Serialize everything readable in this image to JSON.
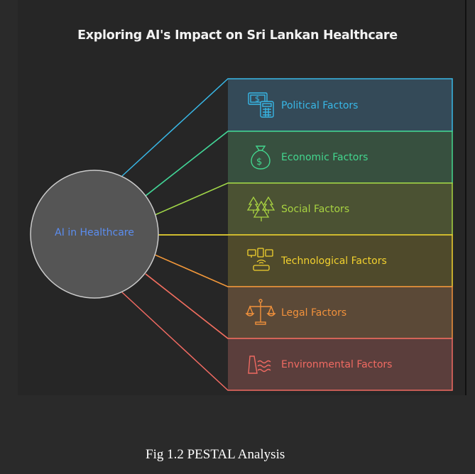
{
  "title": "Exploring AI's Impact on Sri Lankan Healthcare",
  "center": {
    "label": "AI in Healthcare",
    "color": "#5b8def"
  },
  "factors": [
    {
      "label": "Political Factors",
      "color": "#38b7e6",
      "fill": "#344a58",
      "icon": "money-calculator-icon"
    },
    {
      "label": "Economic Factors",
      "color": "#43d68e",
      "fill": "#37503f",
      "icon": "money-bag-icon"
    },
    {
      "label": "Social Factors",
      "color": "#a8d341",
      "fill": "#4b5233",
      "icon": "trees-icon"
    },
    {
      "label": "Technological Factors",
      "color": "#f2d12e",
      "fill": "#4f4a2b",
      "icon": "devices-router-icon"
    },
    {
      "label": "Legal Factors",
      "color": "#f1913b",
      "fill": "#5b4937",
      "icon": "scales-icon"
    },
    {
      "label": "Environmental Factors",
      "color": "#f06a62",
      "fill": "#5b3e3c",
      "icon": "dam-water-icon"
    }
  ],
  "caption": "Fig 1.2 PESTAL Analysis"
}
